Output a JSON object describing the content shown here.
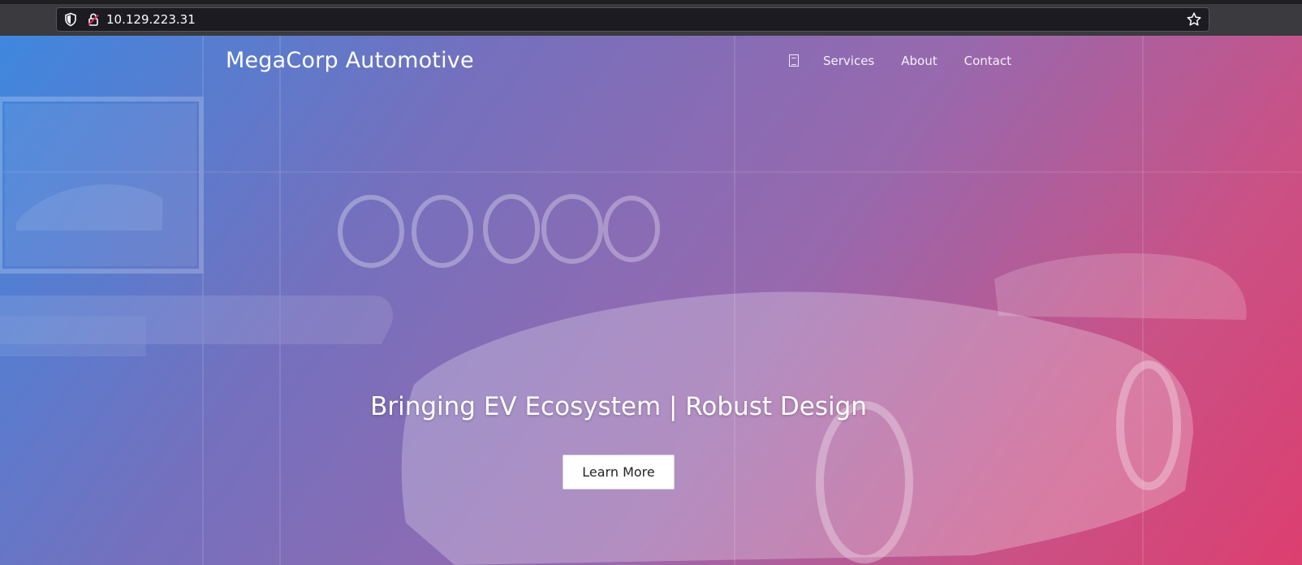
{
  "browser": {
    "url": "10.129.223.31",
    "icons": [
      "shield-icon",
      "lock-icon",
      "star-icon"
    ]
  },
  "site": {
    "brand": "MegaCorp Automotive",
    "nav": {
      "items": [
        {
          "label": "Services"
        },
        {
          "label": "About"
        },
        {
          "label": "Contact"
        }
      ]
    },
    "hero": {
      "headline": "Bringing EV Ecosystem | Robust Design",
      "cta_label": "Learn More"
    }
  },
  "colors": {
    "gradient_start": "#2e7ddc",
    "gradient_mid": "#8750a0",
    "gradient_end": "#da3468",
    "cta_bg": "#ffffff"
  }
}
